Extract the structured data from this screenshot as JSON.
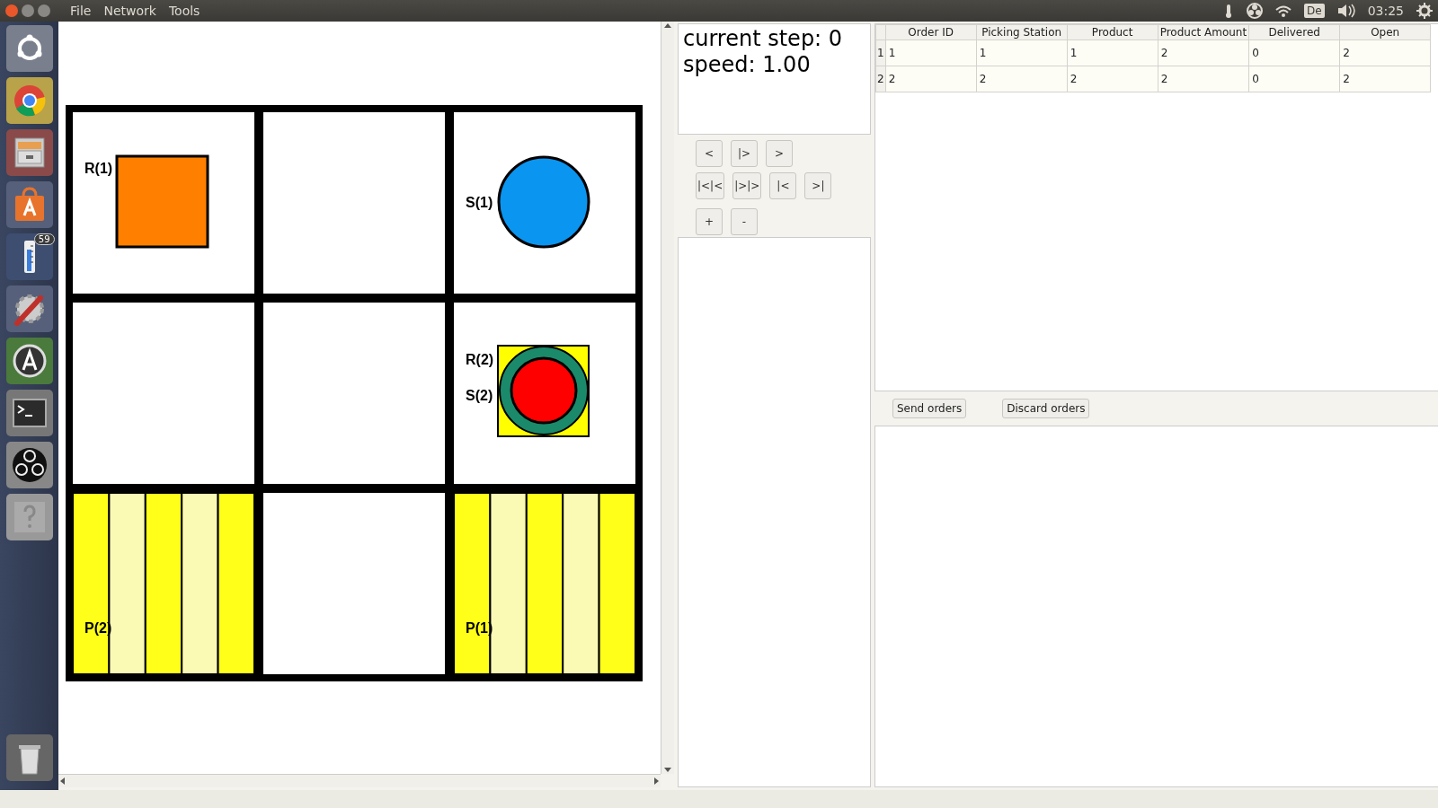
{
  "window": {
    "controls": [
      {
        "kind": "close"
      },
      {
        "kind": "minimize"
      },
      {
        "kind": "maximize"
      }
    ]
  },
  "menu": [
    {
      "label": "File"
    },
    {
      "label": "Network"
    },
    {
      "label": "Tools"
    }
  ],
  "tray": {
    "keyboard": "De",
    "time": "03:25"
  },
  "launcher": [
    {
      "kind": "dash"
    },
    {
      "kind": "browser"
    },
    {
      "kind": "files"
    },
    {
      "kind": "store"
    },
    {
      "kind": "thermometer",
      "badge": "59"
    },
    {
      "kind": "tools"
    },
    {
      "kind": "updater"
    },
    {
      "kind": "terminal"
    },
    {
      "kind": "recorder"
    },
    {
      "kind": "help"
    },
    {
      "kind": "trash"
    }
  ],
  "grid": {
    "cells": [
      {
        "kind": "shelf",
        "labels": [
          "R(1)"
        ]
      },
      {
        "kind": "empty"
      },
      {
        "kind": "station",
        "labels": [
          "S(1)"
        ]
      },
      {
        "kind": "empty"
      },
      {
        "kind": "empty"
      },
      {
        "kind": "robot_at_station",
        "labels": [
          "R(2)",
          "S(2)"
        ]
      },
      {
        "kind": "picking",
        "labels": [
          "P(2)"
        ]
      },
      {
        "kind": "empty"
      },
      {
        "kind": "picking",
        "labels": [
          "P(1)"
        ]
      }
    ]
  },
  "info": {
    "lines": [
      "current step: 0",
      "speed: 1.00"
    ]
  },
  "control_buttons": [
    [
      "<",
      "|>",
      ">"
    ],
    [
      "|<|<",
      "|>|>",
      "|<",
      ">|"
    ],
    [
      "+",
      "-"
    ]
  ],
  "orders": {
    "columns": [
      "Order ID",
      "Picking Station",
      "Product",
      "Product Amount",
      "Delivered",
      "Open"
    ],
    "rows": [
      {
        "number": "1",
        "cells": [
          "1",
          "1",
          "1",
          "2",
          "0",
          "2"
        ]
      },
      {
        "number": "2",
        "cells": [
          "2",
          "2",
          "2",
          "2",
          "0",
          "2"
        ]
      }
    ],
    "buttons": [
      "Send orders",
      "Discard orders"
    ]
  }
}
